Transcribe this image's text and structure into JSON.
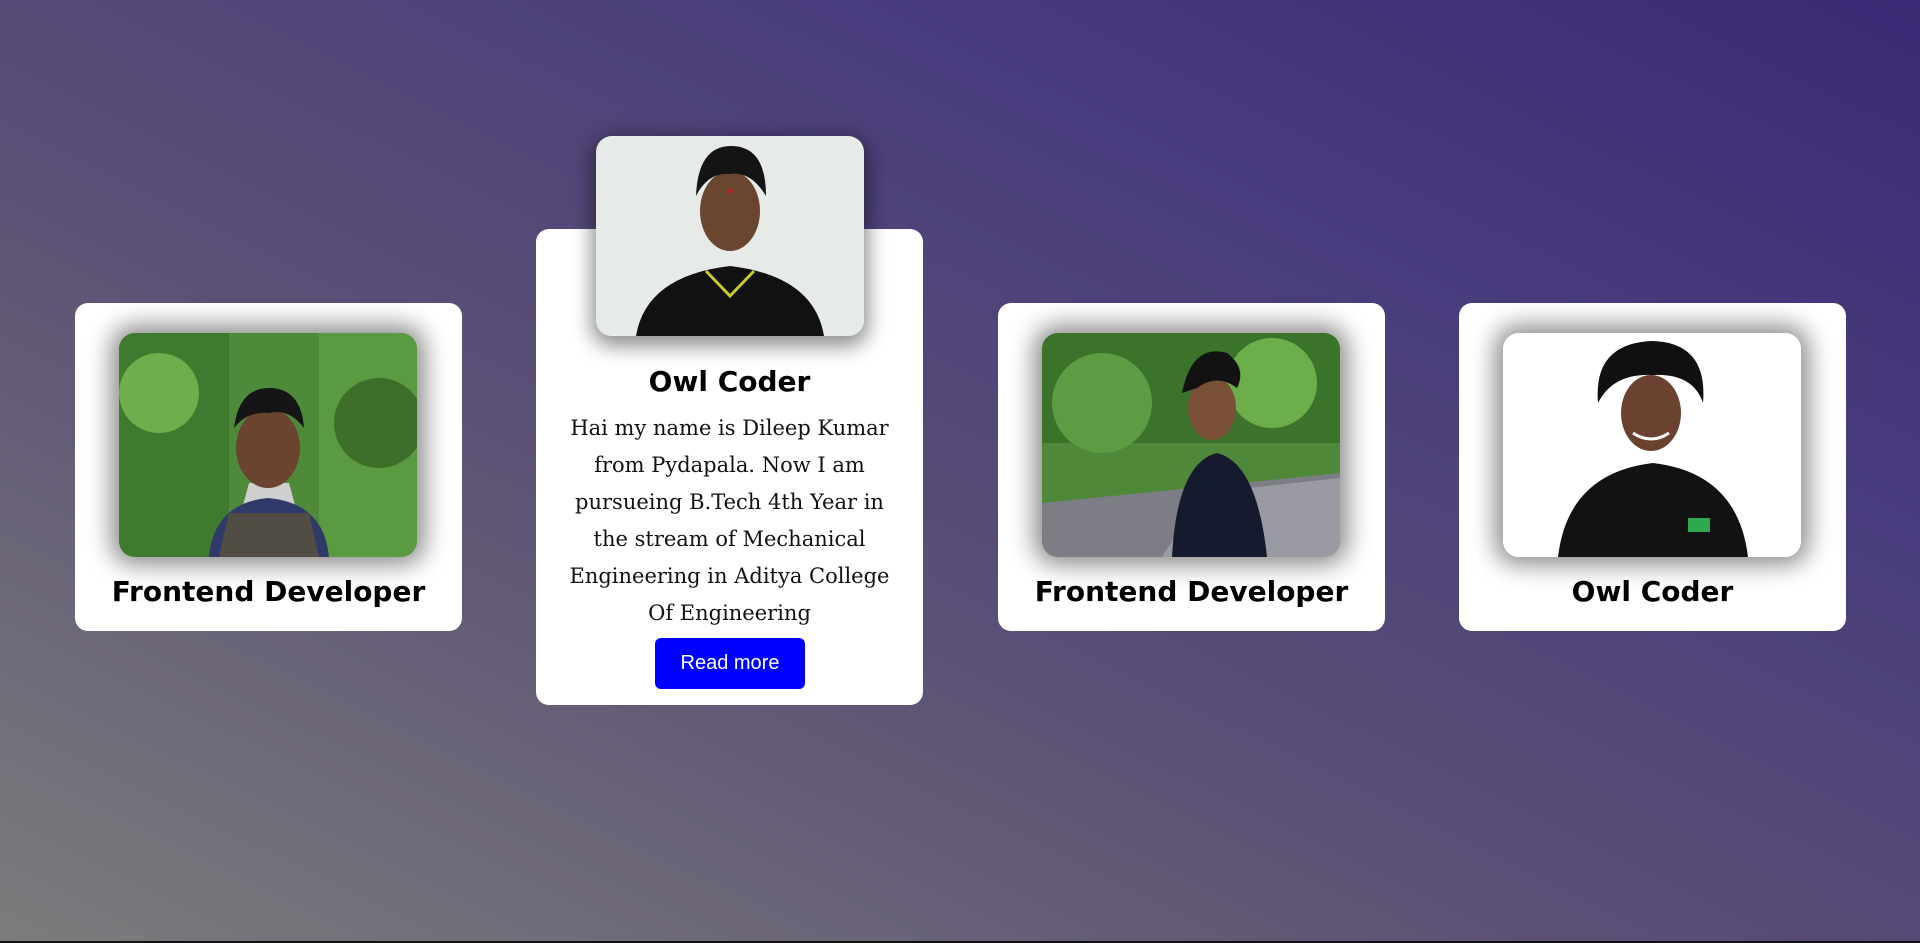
{
  "cards": [
    {
      "title": "Frontend Developer",
      "photo_alt": "Portrait of young man in plaid shirt on tree-lined road"
    },
    {
      "title": "Owl Coder",
      "description": "Hai my name is Dileep Kumar from Pydapala. Now I am pursueing B.Tech 4th Year in the stream of Mechanical Engineering in Aditya College Of Engineering",
      "button_label": "Read more",
      "photo_alt": "Portrait of young man in black polo shirt"
    },
    {
      "title": "Frontend Developer",
      "photo_alt": "Young man in black t-shirt looking sideways on road"
    },
    {
      "title": "Owl Coder",
      "photo_alt": "Smiling young man in black polo with crossed arms"
    }
  ],
  "colors": {
    "card_background": "#ffffff",
    "button_background": "#0000ff",
    "button_text": "#ffffff"
  }
}
